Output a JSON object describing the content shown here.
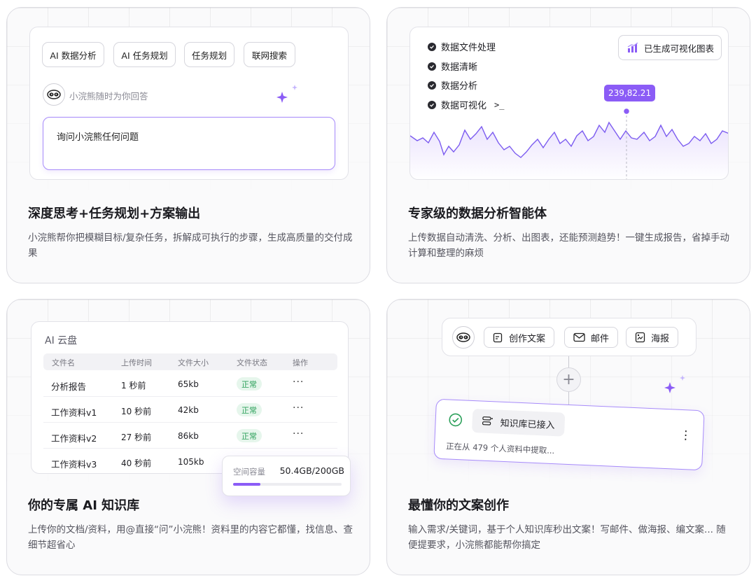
{
  "cards": [
    {
      "title": "深度思考+任务规划+方案输出",
      "desc": "小浣熊帮你把模糊目标/复杂任务，拆解成可执行的步骤，生成高质量的交付成果",
      "chips": [
        "AI 数据分析",
        "AI 任务规划",
        "任务规划",
        "联网搜索"
      ],
      "assistant_hint": "小浣熊随时为你回答",
      "input_placeholder": "询问小浣熊任何问题"
    },
    {
      "title": "专家级的数据分析智能体",
      "desc": "上传数据自动清洗、分析、出图表，还能预测趋势！一键生成报告，省掉手动计算和整理的麻烦",
      "steps": [
        "数据文件处理",
        "数据清晰",
        "数据分析",
        "数据可视化"
      ],
      "terminal_glyph": ">_",
      "badge_label": "已生成可视化图表",
      "tooltip": "239,82.21"
    },
    {
      "title": "你的专属 AI 知识库",
      "desc": "上传你的文档/资料，用@直接“问”小浣熊！资料里的内容它都懂，找信息、查细节超省心",
      "panel_title": "AI 云盘",
      "columns": [
        "文件名",
        "上传时间",
        "文件大小",
        "文件状态",
        "操作"
      ],
      "rows": [
        {
          "name": "分析报告",
          "time": "1 秒前",
          "size": "65kb",
          "status": "正常"
        },
        {
          "name": "工作资料v1",
          "time": "10 秒前",
          "size": "42kb",
          "status": "正常"
        },
        {
          "name": "工作资料v2",
          "time": "27 秒前",
          "size": "86kb",
          "status": "正常"
        },
        {
          "name": "工作资料v3",
          "time": "40 秒前",
          "size": "105kb",
          "status": ""
        }
      ],
      "more_glyph": "···",
      "storage_label": "空间容量",
      "storage_value": "50.4GB/200GB",
      "storage_fraction": 0.252
    },
    {
      "title": "最懂你的文案创作",
      "desc": "输入需求/关键词，基于个人知识库秒出文案！写邮件、做海报、编文案... 随便提要求，小浣熊都能帮你搞定",
      "tools": [
        {
          "label": "创作文案",
          "icon": "edit-doc-icon"
        },
        {
          "label": "邮件",
          "icon": "mail-icon"
        },
        {
          "label": "海报",
          "icon": "poster-icon"
        }
      ],
      "kb_label": "知识库已接入",
      "kb_status": "正在从 479 个人资料中提取...",
      "plus_glyph": "+",
      "kebab_glyph": "⋮"
    }
  ],
  "colors": {
    "accent": "#8b5cf6",
    "accent_light": "#ede7fe",
    "success": "#2ca05a",
    "success_bg": "#e6f6ec"
  }
}
